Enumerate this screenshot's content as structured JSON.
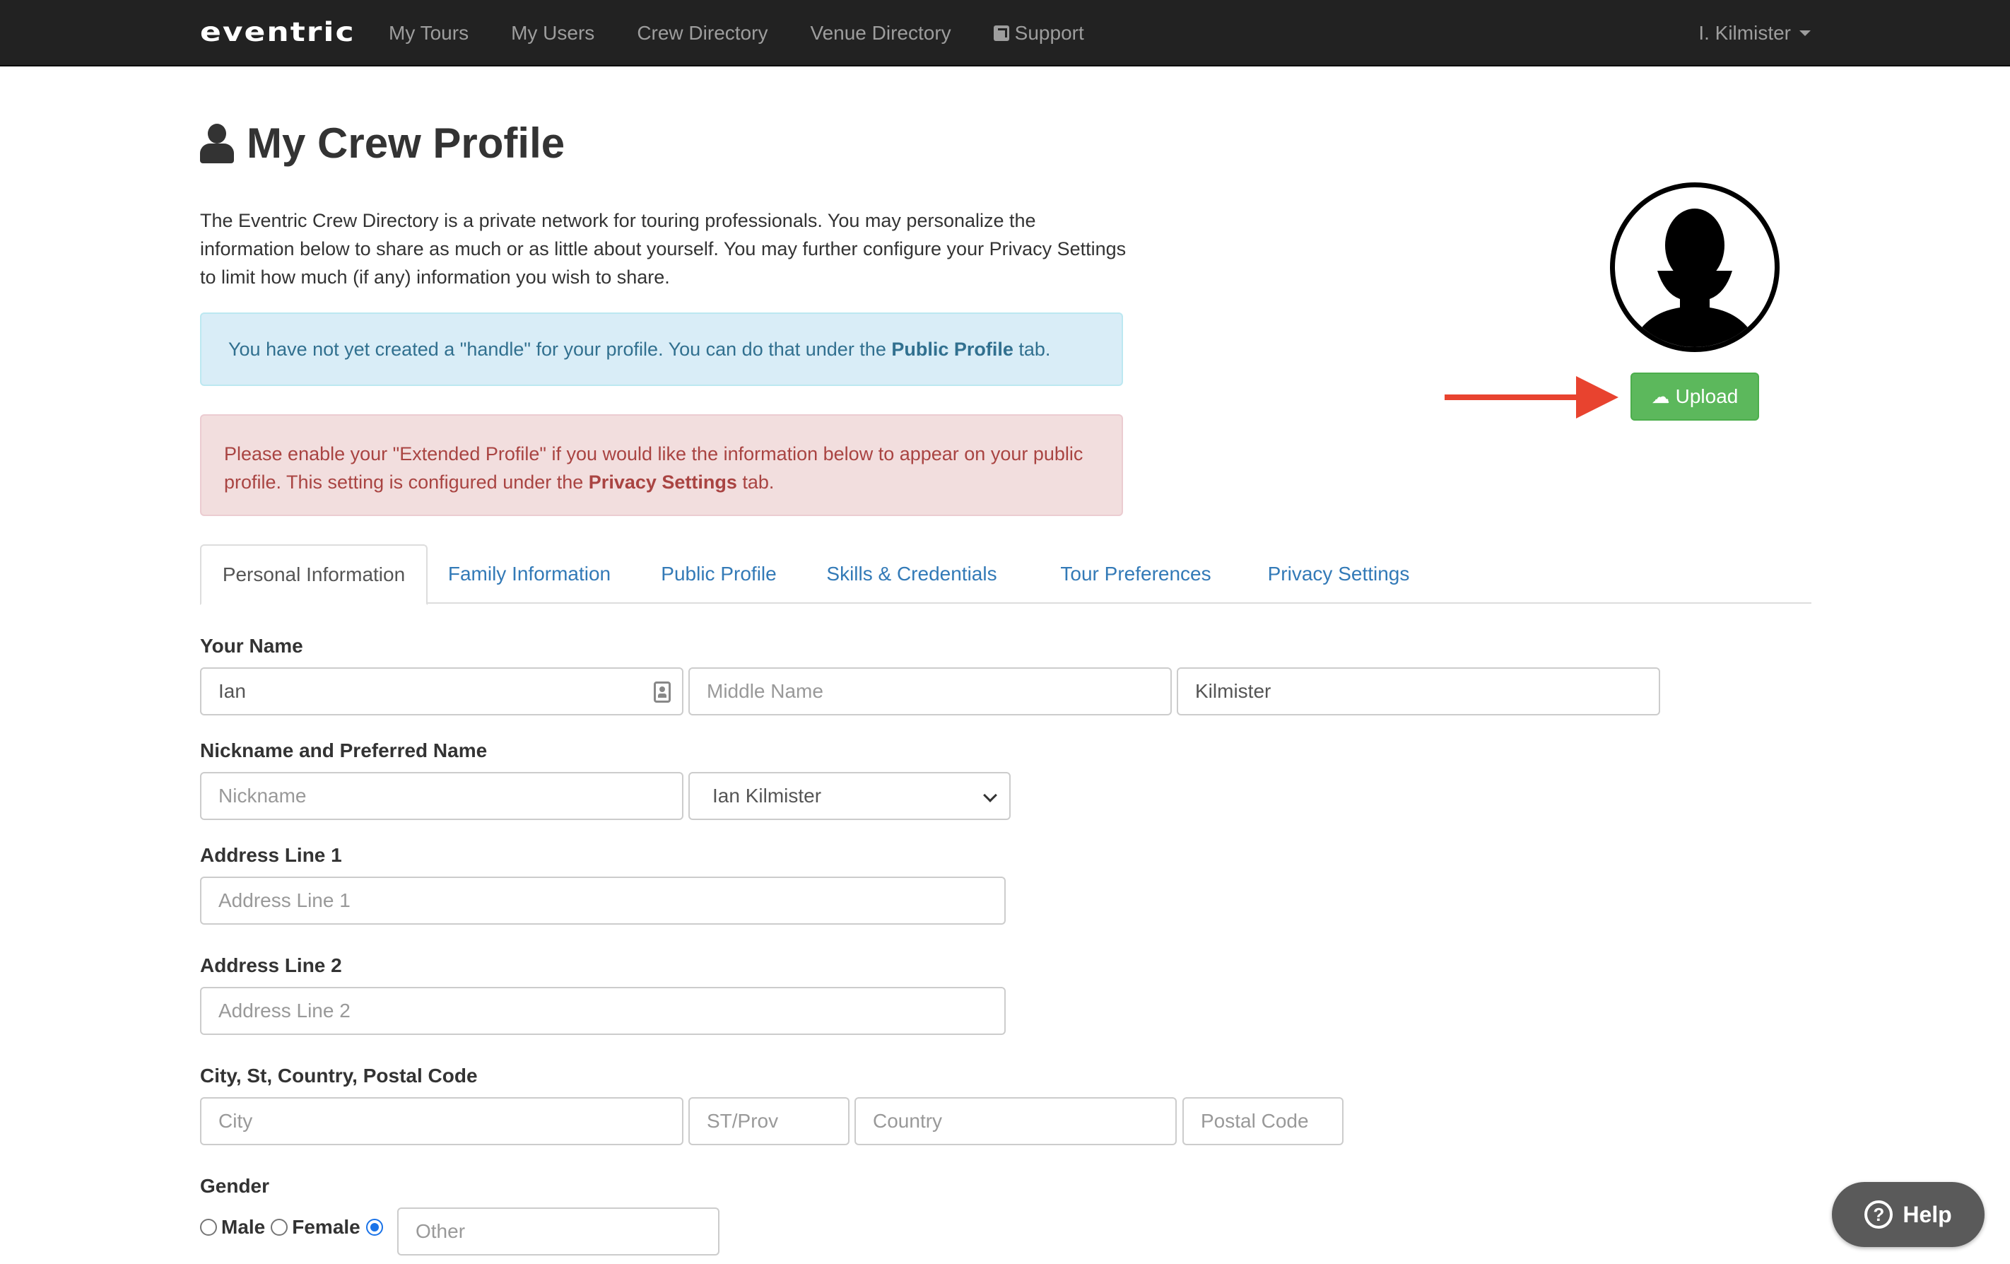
{
  "navbar": {
    "brand": "eventric",
    "links": [
      "My Tours",
      "My Users",
      "Crew Directory",
      "Venue Directory"
    ],
    "support": "Support",
    "user": "I. Kilmister"
  },
  "header": {
    "title": "My Crew Profile",
    "intro": "The Eventric Crew Directory is a private network for touring professionals. You may personalize the information below to share as much or as little about yourself. You may further configure your Privacy Settings to limit how much (if any) information you wish to share."
  },
  "alerts": {
    "info_pre": "You have not yet created a \"handle\" for your profile. You can do that under the ",
    "info_bold": "Public Profile",
    "info_post": " tab.",
    "danger_pre": "Please enable your \"Extended Profile\" if you would like the information below to appear on your public profile. This setting is configured under the ",
    "danger_bold": "Privacy Settings",
    "danger_post": " tab."
  },
  "avatar": {
    "upload_label": "Upload"
  },
  "tabs": [
    "Personal Information",
    "Family Information",
    "Public Profile",
    "Skills & Credentials",
    "Tour Preferences",
    "Privacy Settings"
  ],
  "form": {
    "your_name_label": "Your Name",
    "first_name": "Ian",
    "middle_placeholder": "Middle Name",
    "last_name": "Kilmister",
    "nickname_label": "Nickname and Preferred Name",
    "nickname_placeholder": "Nickname",
    "preferred_name": "Ian Kilmister",
    "address1_label": "Address Line 1",
    "address1_placeholder": "Address Line 1",
    "address2_label": "Address Line 2",
    "address2_placeholder": "Address Line 2",
    "city_label": "City, St, Country, Postal Code",
    "city_placeholder": "City",
    "state_placeholder": "ST/Prov",
    "country_placeholder": "Country",
    "postal_placeholder": "Postal Code",
    "gender_label": "Gender",
    "gender_male": "Male",
    "gender_female": "Female",
    "gender_other_placeholder": "Other",
    "gender_selected": "Other"
  },
  "help": {
    "label": "Help"
  },
  "colors": {
    "navbar_bg": "#222222",
    "link": "#337ab7",
    "success": "#5cb85c",
    "arrow": "#e8432f",
    "help_bg": "#5a5a5a"
  }
}
